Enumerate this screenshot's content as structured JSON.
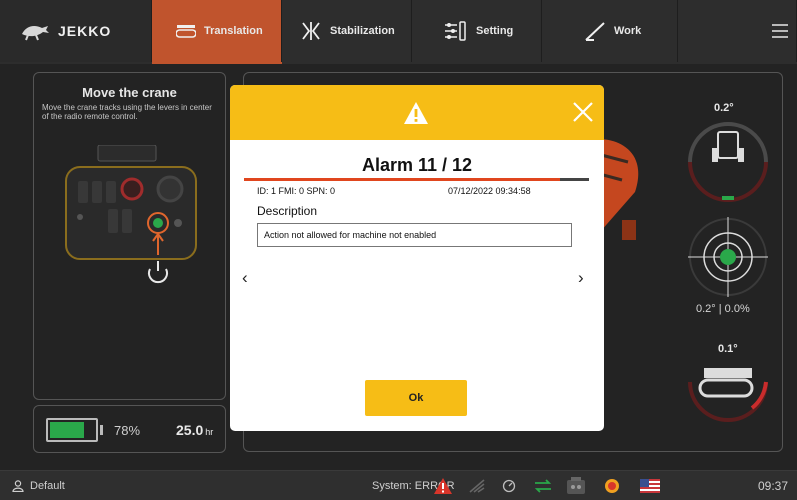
{
  "app": {
    "logo_text": "JEKKO"
  },
  "tabs": [
    {
      "label": "Translation",
      "icon": "crane-tracks-icon",
      "active": true
    },
    {
      "label": "Stabilization",
      "icon": "stabilizers-icon",
      "active": false
    },
    {
      "label": "Setting",
      "icon": "sliders-icon",
      "active": false
    },
    {
      "label": "Work",
      "icon": "boom-icon",
      "active": false
    }
  ],
  "menu_icon": "hamburger-menu-icon",
  "instructions": {
    "title": "Move the crane",
    "text": "Move the crane tracks using the levers in center of the radio remote control."
  },
  "battery": {
    "percent_label": "78%",
    "percent": 78,
    "hours": "25.0",
    "hours_unit": "hr"
  },
  "gauges": {
    "tilt": "0.2°",
    "level": "0.2° | 0.0%",
    "slew": "0.1°"
  },
  "alarm": {
    "title": "Alarm 11 / 12",
    "progress": 0.917,
    "ids": "ID: 1  FMI: 0  SPN: 0",
    "timestamp": "07/12/2022 09:34:58",
    "description_label": "Description",
    "description": "Action not allowed for machine not enabled",
    "ok_label": "Ok",
    "prev": "‹",
    "next": "›"
  },
  "status": {
    "profile": "Default",
    "system": "System: ERROR",
    "time": "09:37"
  },
  "colors": {
    "accent": "#c0542d",
    "dialog_header": "#f6bd16",
    "battery": "#2aa84a",
    "alarm_red": "#e0461e"
  }
}
